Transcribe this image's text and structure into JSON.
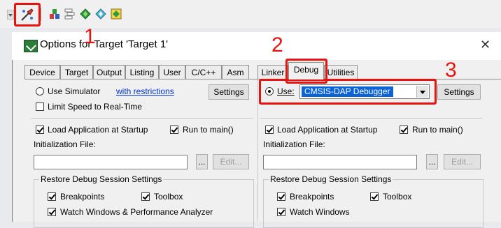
{
  "dialog": {
    "title": "Options for Target 'Target 1'",
    "close": "✕"
  },
  "tabs": [
    "Device",
    "Target",
    "Output",
    "Listing",
    "User",
    "C/C++",
    "Asm",
    "Linker",
    "Debug",
    "Utilities"
  ],
  "active_tab": "Debug",
  "left": {
    "use_simulator": "Use Simulator",
    "restrictions_link": "with restrictions",
    "settings": "Settings",
    "limit_speed": "Limit Speed to Real-Time",
    "load_app": "Load Application at Startup",
    "run_main": "Run to main()",
    "init_file": "Initialization File:",
    "browse": "...",
    "edit": "Edit...",
    "restore_title": "Restore Debug Session Settings",
    "breakpoints": "Breakpoints",
    "toolbox": "Toolbox",
    "watch": "Watch Windows & Performance Analyzer"
  },
  "right": {
    "use": "Use:",
    "debugger": "CMSIS-DAP Debugger",
    "settings": "Settings",
    "load_app": "Load Application at Startup",
    "run_main": "Run to main()",
    "init_file": "Initialization File:",
    "browse": "...",
    "edit": "Edit...",
    "restore_title": "Restore Debug Session Settings",
    "breakpoints": "Breakpoints",
    "toolbox": "Toolbox",
    "watch": "Watch Windows"
  },
  "annotations": [
    "1",
    "2",
    "3"
  ],
  "colors": {
    "annotation": "#e8130f",
    "selection": "#0a64d8",
    "link": "#0033cc"
  }
}
